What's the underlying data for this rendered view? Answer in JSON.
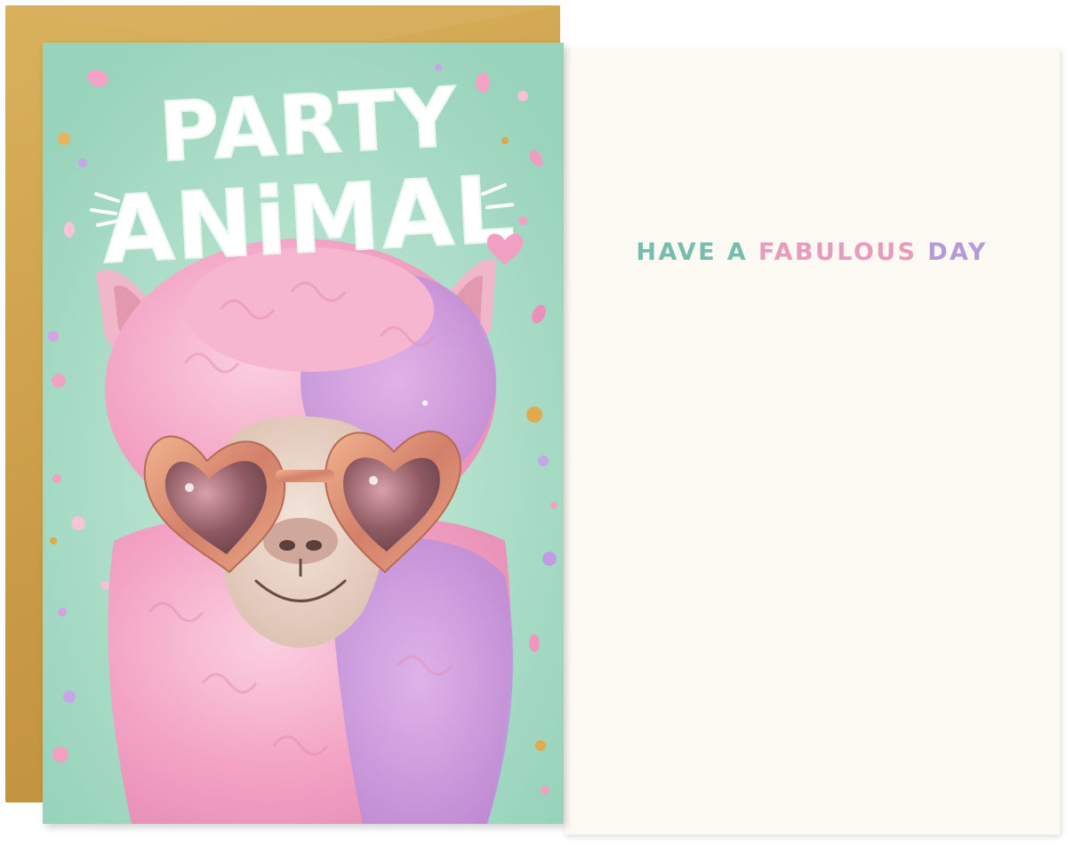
{
  "cover": {
    "title_line1": "PARTY",
    "title_line2": "ANiMAL"
  },
  "inside": {
    "greeting_words": [
      "HAVE",
      "A",
      "FABULOUS",
      "DAY"
    ]
  },
  "colors": {
    "cover_background": "#a8dcc6",
    "envelope": "#cda048",
    "card_inside": "#fdfaf3",
    "greeting_teal": "#76bdb0",
    "greeting_pink": "#e79bbd",
    "greeting_purple": "#b59ad6",
    "fur_pink": "#f6a9c8",
    "fur_purple": "#c89ae0",
    "glitter_frame": "#d9876a"
  },
  "icons": {
    "sunglasses": "heart-sunglasses-icon",
    "heart": "heart-icon",
    "confetti": "confetti-icon"
  }
}
